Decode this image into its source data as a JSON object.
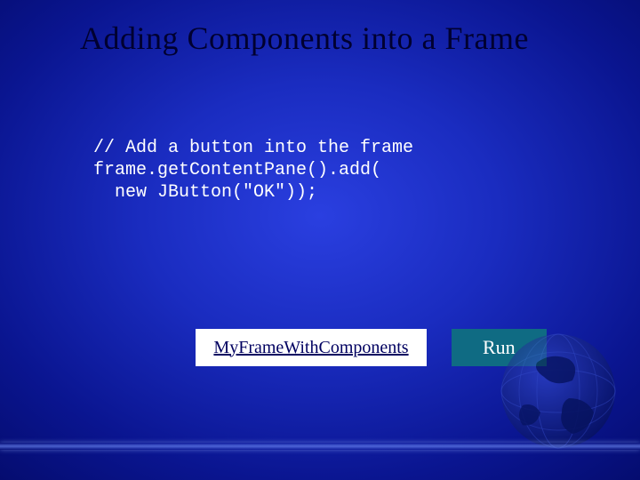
{
  "title": "Adding Components into a Frame",
  "code": "// Add a button into the frame\nframe.getContentPane().add(\n  new JButton(\"OK\"));",
  "link_button_label": "MyFrameWithComponents",
  "run_button_label": "Run"
}
